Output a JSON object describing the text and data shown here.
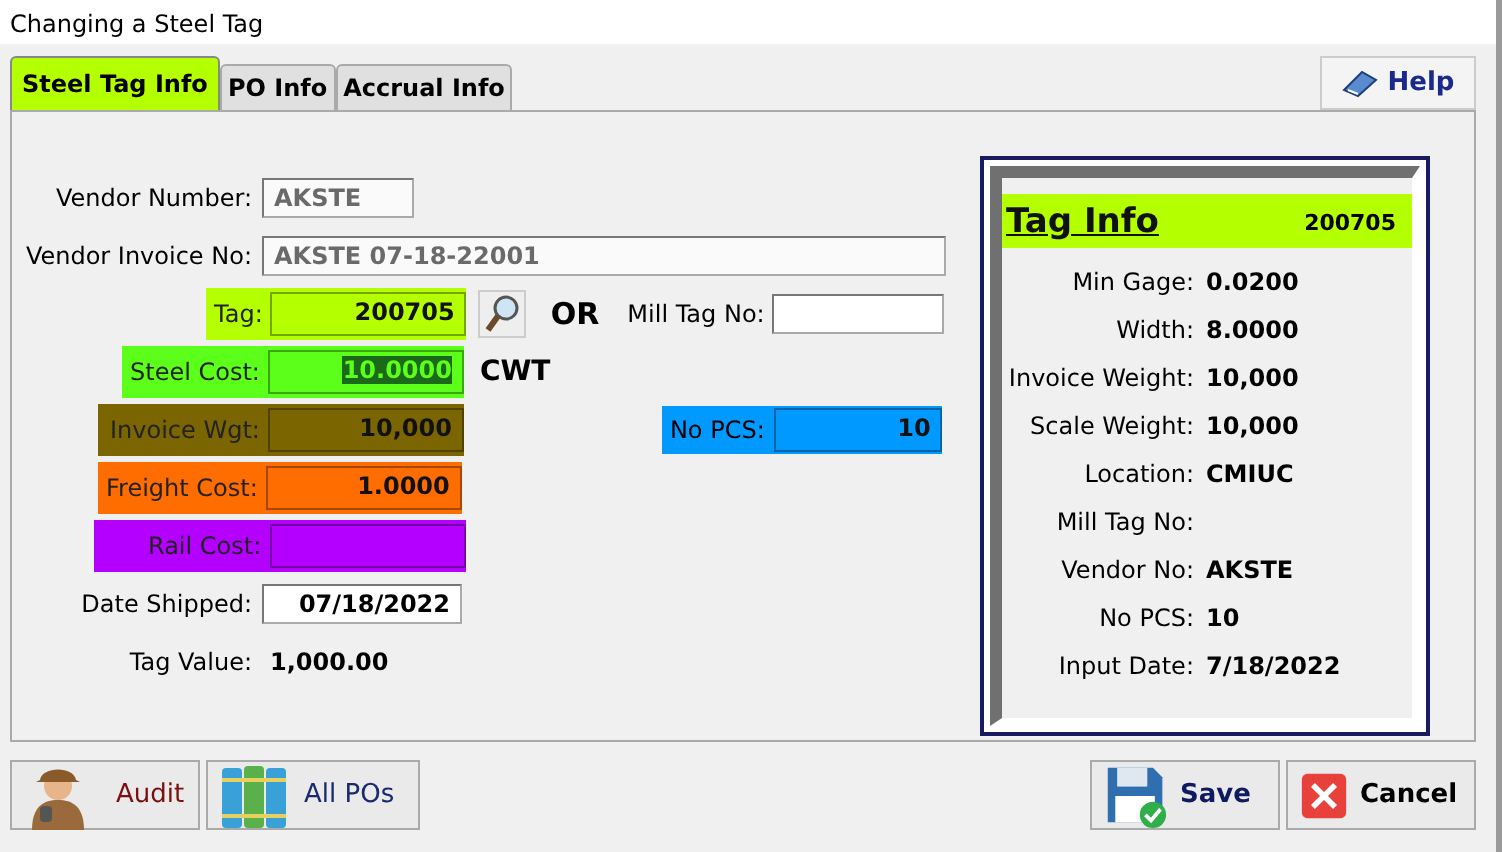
{
  "window": {
    "title": "Changing a Steel Tag"
  },
  "tabs": [
    {
      "label": "Steel Tag Info",
      "selected": true
    },
    {
      "label": "PO Info",
      "selected": false
    },
    {
      "label": "Accrual Info",
      "selected": false
    }
  ],
  "help_button": {
    "label": "Help"
  },
  "form": [
    {
      "label": "Vendor Number:",
      "value": "AKSTE",
      "kind": "short",
      "disabled": true
    },
    {
      "label": "Vendor Invoice No:",
      "value": "AKSTE 07-18-22001",
      "kind": "long",
      "disabled": true
    },
    {
      "label": "Tag:",
      "value": "200705",
      "kind": "tag",
      "color": "#b4ff00",
      "text_selected": false,
      "after": [
        {
          "kind": "search"
        },
        {
          "kind": "text",
          "text": "OR"
        },
        {
          "kind": "label",
          "text": "Mill Tag No:"
        },
        {
          "kind": "field"
        }
      ]
    },
    {
      "label": "Steel Cost:",
      "value": "10.0000",
      "kind": "wide",
      "color": "#5cff1a",
      "text_selected": true,
      "after": [
        {
          "kind": "text",
          "text": "CWT"
        }
      ]
    },
    {
      "label": "Invoice Wgt:",
      "value": "10,000",
      "kind": "wide",
      "color": "#7a6500",
      "text_selected": false,
      "after": [
        {
          "kind": "colored_field",
          "label": "No PCS:",
          "value": "10",
          "color": "#0099ff"
        }
      ]
    },
    {
      "label": "Freight Cost:",
      "value": "1.0000",
      "kind": "wide",
      "color": "#ff6c00",
      "text_selected": false
    },
    {
      "label": "Rail Cost:",
      "kind": "wide",
      "color": "#b300ff"
    },
    {
      "label": "Date Shipped:",
      "value": "07/18/2022",
      "kind": "short",
      "disabled": false
    },
    {
      "label": "Tag Value:",
      "value": "1,000.00",
      "kind": "readout"
    }
  ],
  "tag_info": {
    "title": "Tag Info",
    "tag": "200705",
    "rows": [
      {
        "label": "Min Gage:",
        "value": "0.0200"
      },
      {
        "label": "Width:",
        "value": "8.0000"
      },
      {
        "label": "Invoice Weight:",
        "value": "10,000"
      },
      {
        "label": "Scale Weight:",
        "value": "10,000"
      },
      {
        "label": "Location:",
        "value": "CMIUC"
      },
      {
        "label": "Mill Tag No:"
      },
      {
        "label": "Vendor No:",
        "value": "AKSTE"
      },
      {
        "label": "No PCS:",
        "value": "10"
      },
      {
        "label": "Input Date:",
        "value": "7/18/2022"
      }
    ]
  },
  "buttons": [
    {
      "label": "Audit",
      "kind": "audit"
    },
    {
      "label": "All POs",
      "kind": "pos"
    },
    {
      "label": "Save",
      "kind": "save"
    },
    {
      "label": "Cancel",
      "kind": "cancel"
    }
  ]
}
